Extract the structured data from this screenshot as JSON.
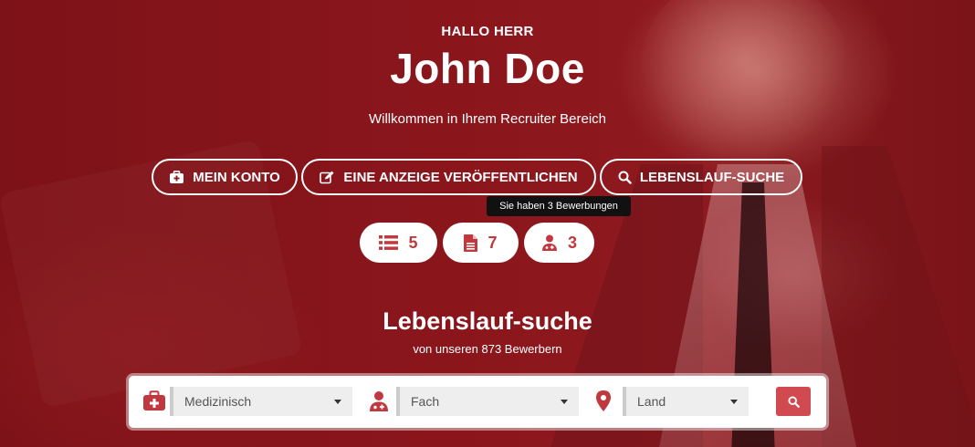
{
  "colors": {
    "accent": "#c0393e",
    "hero_overlay": "#861418",
    "button_red": "#d14a4f"
  },
  "header": {
    "greeting": "HALLO HERR",
    "name": "John Doe",
    "welcome": "Willkommen in Ihrem Recruiter Bereich"
  },
  "actions": [
    {
      "label": "MEIN KONTO",
      "icon": "briefcase-medical-icon"
    },
    {
      "label": "EINE ANZEIGE VERÖFFENTLICHEN",
      "icon": "edit-icon"
    },
    {
      "label": "LEBENSLAUF-SUCHE",
      "icon": "search-icon"
    }
  ],
  "tooltip": "Sie haben 3 Bewerbungen",
  "stats": [
    {
      "value": "5",
      "icon": "list-icon"
    },
    {
      "value": "7",
      "icon": "document-icon"
    },
    {
      "value": "3",
      "icon": "user-doctor-icon"
    }
  ],
  "search": {
    "title": "Lebenslauf-suche",
    "subtitle": "von unseren 873 Bewerbern",
    "fields": [
      {
        "value": "Medizinisch",
        "icon": "medical-kit-icon"
      },
      {
        "value": "Fach",
        "icon": "doctor-icon"
      },
      {
        "value": "Land",
        "icon": "map-marker-icon"
      }
    ],
    "submit_icon": "search-icon"
  }
}
